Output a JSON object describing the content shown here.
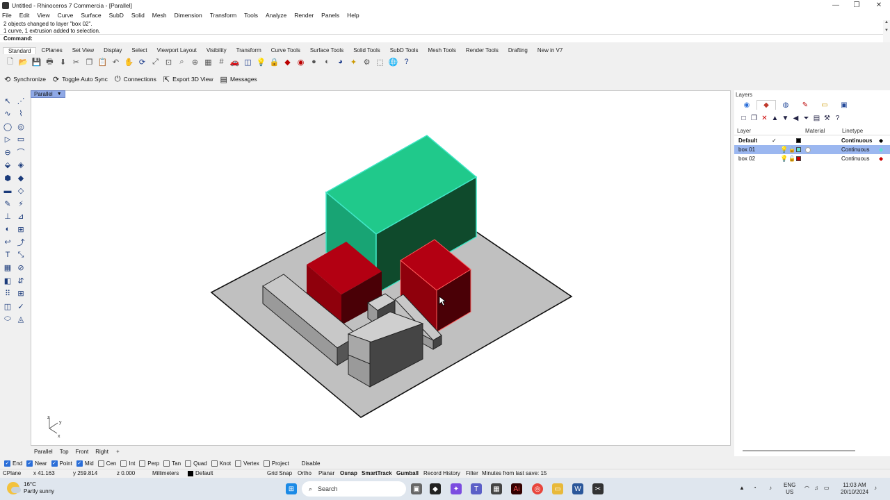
{
  "window": {
    "title": "Untitled - Rhinoceros 7 Commercia - [Parallel]"
  },
  "menu": [
    "File",
    "Edit",
    "View",
    "Curve",
    "Surface",
    "SubD",
    "Solid",
    "Mesh",
    "Dimension",
    "Transform",
    "Tools",
    "Analyze",
    "Render",
    "Panels",
    "Help"
  ],
  "history": [
    "2 objects changed to layer \"box 02\".",
    "1 curve, 1 extrusion added to selection."
  ],
  "command": {
    "label": "Command:",
    "value": ""
  },
  "toolbar_tabs": [
    "Standard",
    "CPlanes",
    "Set View",
    "Display",
    "Select",
    "Viewport Layout",
    "Visibility",
    "Transform",
    "Curve Tools",
    "Surface Tools",
    "Solid Tools",
    "SubD Tools",
    "Mesh Tools",
    "Render Tools",
    "Drafting",
    "New in V7"
  ],
  "toolbar_icons": [
    "new-icon",
    "open-icon",
    "save-icon",
    "print-icon",
    "import-icon",
    "cut-icon",
    "copy-icon",
    "paste-icon",
    "undo-icon",
    "pan-icon",
    "rotate-view-icon",
    "zoom-extents-icon",
    "zoom-window-icon",
    "zoom-icon",
    "zoom-selected-icon",
    "viewports-icon",
    "grid-icon",
    "car-icon",
    "cplane-icon",
    "light-icon",
    "lock-icon",
    "render-icon",
    "color-icon",
    "sphere-icon",
    "shaded-icon",
    "render-sphere-icon",
    "wand-icon",
    "settings-icon",
    "select-icon",
    "globe-icon",
    "help-icon"
  ],
  "subtools": [
    {
      "icon": "sync-icon",
      "label": "Synchronize"
    },
    {
      "icon": "auto-sync-icon",
      "label": "Toggle Auto Sync"
    },
    {
      "icon": "plug-icon",
      "label": "Connections"
    },
    {
      "icon": "export-icon",
      "label": "Export 3D View"
    },
    {
      "icon": "messages-icon",
      "label": "Messages"
    }
  ],
  "viewport": {
    "name": "Parallel",
    "axes": {
      "x": "x",
      "y": "y",
      "z": "z"
    }
  },
  "view_tabs": [
    "Parallel",
    "Top",
    "Front",
    "Right"
  ],
  "layers_panel": {
    "title": "Layers",
    "columns": {
      "layer": "Layer",
      "material": "Material",
      "linetype": "Linetype"
    },
    "rows": [
      {
        "name": "Default",
        "current": true,
        "color": "#000000",
        "linetype": "Continuous"
      },
      {
        "name": "box 01",
        "selected": true,
        "color": "#5de2d0",
        "linetype": "Continuous"
      },
      {
        "name": "box 02",
        "color": "#cc0000",
        "linetype": "Continuous"
      }
    ]
  },
  "osnaps": [
    {
      "label": "End",
      "on": true
    },
    {
      "label": "Near",
      "on": true
    },
    {
      "label": "Point",
      "on": true
    },
    {
      "label": "Mid",
      "on": true
    },
    {
      "label": "Cen",
      "on": false
    },
    {
      "label": "Int",
      "on": false
    },
    {
      "label": "Perp",
      "on": false
    },
    {
      "label": "Tan",
      "on": false
    },
    {
      "label": "Quad",
      "on": false
    },
    {
      "label": "Knot",
      "on": false
    },
    {
      "label": "Vertex",
      "on": false
    },
    {
      "label": "Project",
      "on": false
    },
    {
      "label": "Disable",
      "on": false
    }
  ],
  "statusbar": {
    "cplane": "CPlane",
    "x": "x 41.163",
    "y": "y 259.814",
    "z": "z 0.000",
    "units": "Millimeters",
    "layer": "Default",
    "toggles": [
      "Grid Snap",
      "Ortho",
      "Planar",
      "Osnap",
      "SmartTrack",
      "Gumball",
      "Record History",
      "Filter"
    ],
    "bold_toggles": [
      "Osnap",
      "SmartTrack",
      "Gumball"
    ],
    "save_info": "Minutes from last save: 15"
  },
  "taskbar": {
    "weather_temp": "16°C",
    "weather_desc": "Partly sunny",
    "search": "Search",
    "lang": "ENG",
    "region": "US",
    "time": "11:03 AM",
    "date": "20/10/2024"
  },
  "colors": {
    "green_box": "#1fc98a",
    "red_box": "#a30010",
    "plate": "#c0c0c0",
    "selection": "#5de2d0"
  }
}
